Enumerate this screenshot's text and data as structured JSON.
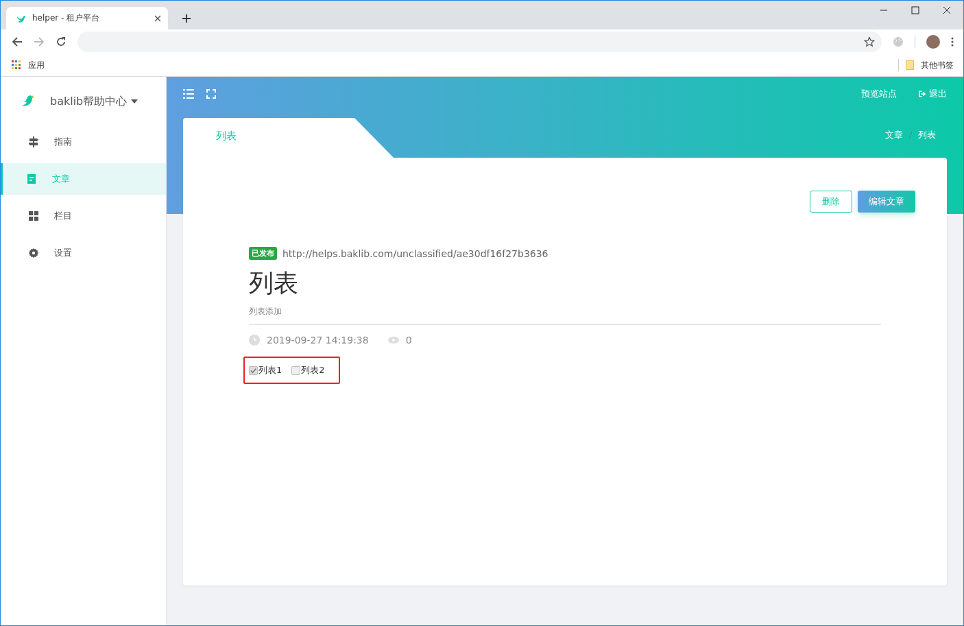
{
  "browser": {
    "tab_title": "helper - 租户平台",
    "bookmarks": [
      {
        "label": "应用",
        "kind": "apps"
      },
      {
        "label": "其他书签",
        "kind": "folder"
      }
    ]
  },
  "sidebar": {
    "brand": "baklib帮助中心",
    "items": [
      {
        "label": "指南",
        "kind": "signpost",
        "selected": false
      },
      {
        "label": "文章",
        "kind": "document",
        "selected": true
      },
      {
        "label": "栏目",
        "kind": "grid",
        "selected": false
      },
      {
        "label": "设置",
        "kind": "gear",
        "selected": false
      }
    ]
  },
  "header": {
    "links": [
      {
        "label": "预览站点",
        "kind": "plain"
      },
      {
        "label": "退出",
        "kind": "logout"
      }
    ]
  },
  "page_tab": "列表",
  "breadcrumb": [
    "文章",
    "列表"
  ],
  "actions": [
    {
      "label": "删除",
      "kind": "outline"
    },
    {
      "label": "编辑文章",
      "kind": "primary"
    }
  ],
  "article": {
    "status": "已发布",
    "url": "http://helps.baklib.com/unclassified/ae30df16f27b3636",
    "title": "列表",
    "summary": "列表添加",
    "date": "2019-09-27 14:19:38",
    "views": "0",
    "checklist": [
      {
        "label": "列表1",
        "checked": true
      },
      {
        "label": "列表2",
        "checked": false
      }
    ]
  }
}
